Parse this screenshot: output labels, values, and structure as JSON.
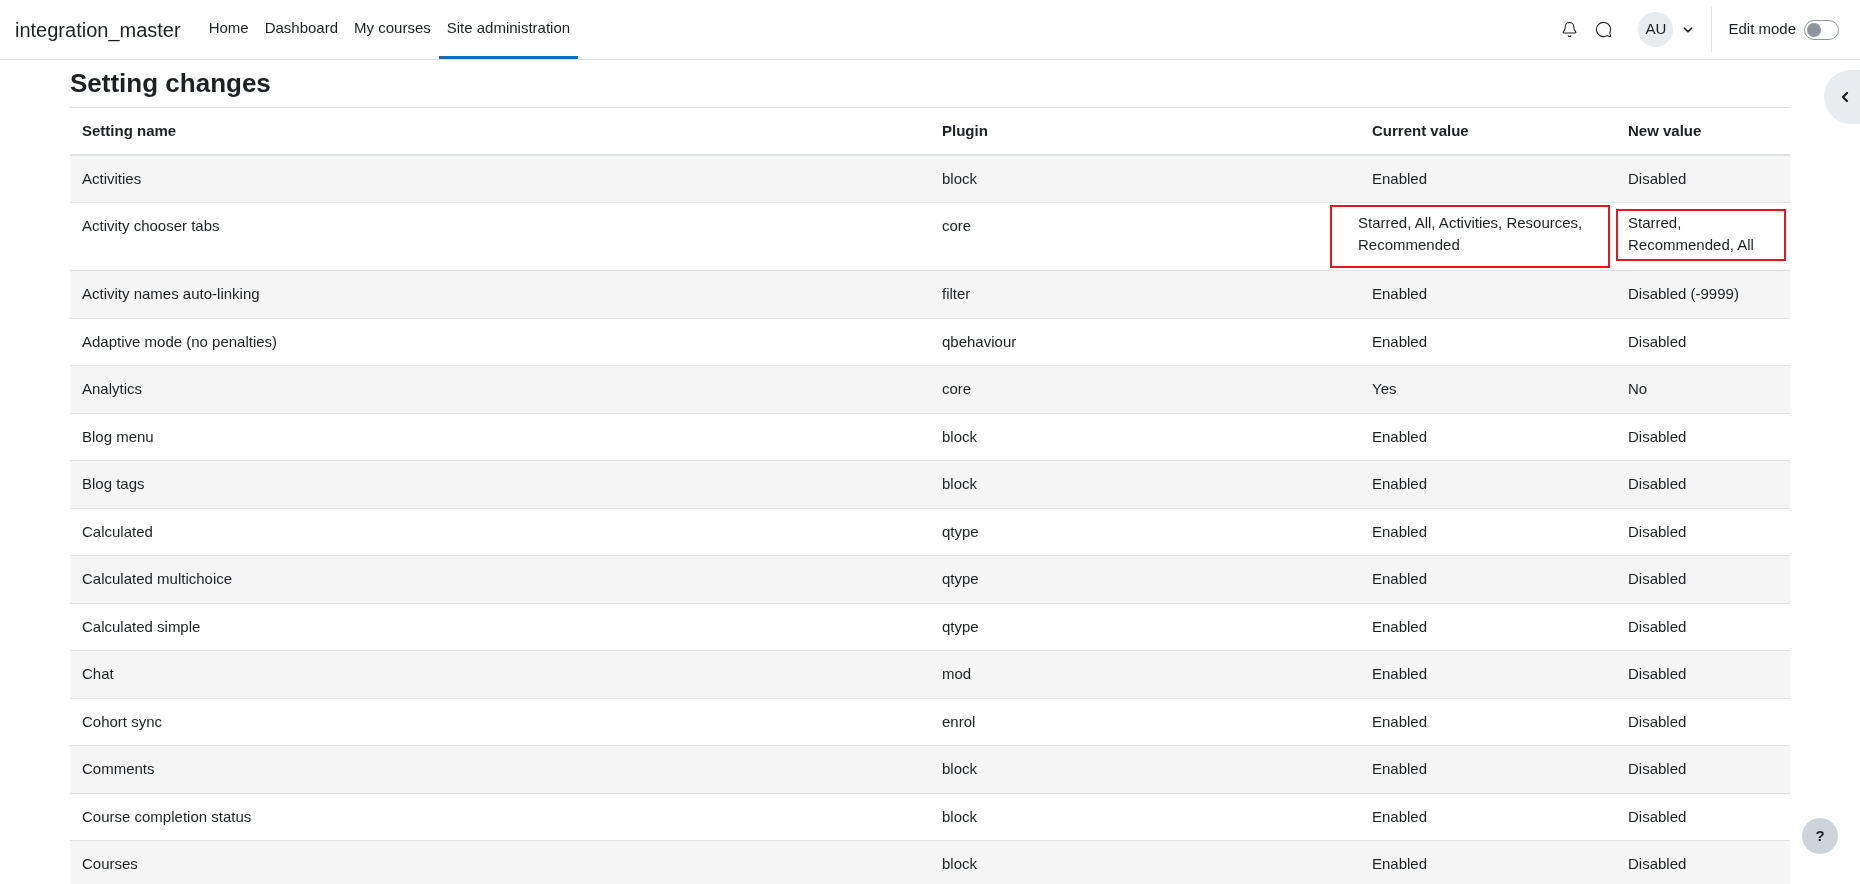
{
  "site_name": "integration_master",
  "nav": [
    {
      "label": "Home",
      "selected": false
    },
    {
      "label": "Dashboard",
      "selected": false
    },
    {
      "label": "My courses",
      "selected": false
    },
    {
      "label": "Site administration",
      "selected": true
    }
  ],
  "user": {
    "initials": "AU"
  },
  "edit_mode": {
    "label": "Edit mode",
    "on": false
  },
  "page_title": "Setting changes",
  "table": {
    "columns": [
      "Setting name",
      "Plugin",
      "Current value",
      "New value"
    ],
    "rows": [
      {
        "name": "Activities",
        "plugin": "block",
        "current": "Enabled",
        "new": "Disabled",
        "highlighted": false
      },
      {
        "name": "Activity chooser tabs",
        "plugin": "core",
        "current": "Starred, All, Activities, Resources, Recommended",
        "new": "Starred, Recommended, All",
        "highlighted": true
      },
      {
        "name": "Activity names auto-linking",
        "plugin": "filter",
        "current": "Enabled",
        "new": "Disabled (-9999)",
        "highlighted": false
      },
      {
        "name": "Adaptive mode (no penalties)",
        "plugin": "qbehaviour",
        "current": "Enabled",
        "new": "Disabled",
        "highlighted": false
      },
      {
        "name": "Analytics",
        "plugin": "core",
        "current": "Yes",
        "new": "No",
        "highlighted": false
      },
      {
        "name": "Blog menu",
        "plugin": "block",
        "current": "Enabled",
        "new": "Disabled",
        "highlighted": false
      },
      {
        "name": "Blog tags",
        "plugin": "block",
        "current": "Enabled",
        "new": "Disabled",
        "highlighted": false
      },
      {
        "name": "Calculated",
        "plugin": "qtype",
        "current": "Enabled",
        "new": "Disabled",
        "highlighted": false
      },
      {
        "name": "Calculated multichoice",
        "plugin": "qtype",
        "current": "Enabled",
        "new": "Disabled",
        "highlighted": false
      },
      {
        "name": "Calculated simple",
        "plugin": "qtype",
        "current": "Enabled",
        "new": "Disabled",
        "highlighted": false
      },
      {
        "name": "Chat",
        "plugin": "mod",
        "current": "Enabled",
        "new": "Disabled",
        "highlighted": false
      },
      {
        "name": "Cohort sync",
        "plugin": "enrol",
        "current": "Enabled",
        "new": "Disabled",
        "highlighted": false
      },
      {
        "name": "Comments",
        "plugin": "block",
        "current": "Enabled",
        "new": "Disabled",
        "highlighted": false
      },
      {
        "name": "Course completion status",
        "plugin": "block",
        "current": "Enabled",
        "new": "Disabled",
        "highlighted": false
      },
      {
        "name": "Courses",
        "plugin": "block",
        "current": "Enabled",
        "new": "Disabled",
        "highlighted": false
      }
    ]
  },
  "help_button": {
    "label": "?"
  }
}
